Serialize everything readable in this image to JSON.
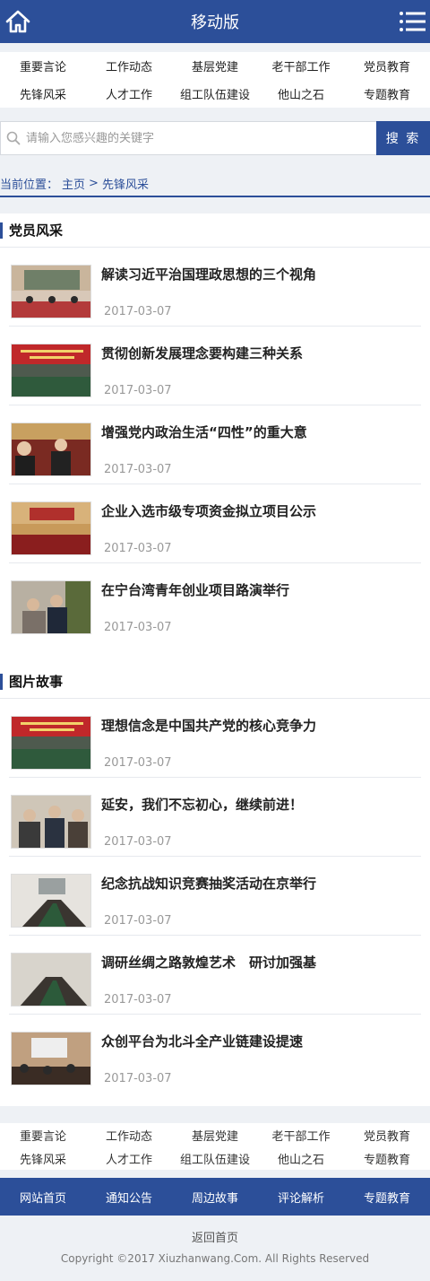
{
  "header": {
    "title": "移动版",
    "home_icon": "home-icon",
    "menu_icon": "menu-icon"
  },
  "topnav": [
    "重要言论",
    "工作动态",
    "基层党建",
    "老干部工作",
    "党员教育",
    "先锋风采",
    "人才工作",
    "组工队伍建设",
    "他山之石",
    "专题教育"
  ],
  "search": {
    "placeholder": "请输入您感兴趣的关键字",
    "button": "搜 索"
  },
  "breadcrumb": {
    "label": "当前位置：",
    "home": "主页",
    "sep": ">",
    "current": "先锋风采"
  },
  "sections": [
    {
      "title": "党员风采",
      "items": [
        {
          "title": "解读习近平治国理政思想的三个视角",
          "date": "2017-03-07"
        },
        {
          "title": "贯彻创新发展理念要构建三种关系",
          "date": "2017-03-07"
        },
        {
          "title": "增强党内政治生活“四性”的重大意",
          "date": "2017-03-07"
        },
        {
          "title": "企业入选市级专项资金拟立项目公示",
          "date": "2017-03-07"
        },
        {
          "title": "在宁台湾青年创业项目路演举行",
          "date": "2017-03-07"
        }
      ]
    },
    {
      "title": "图片故事",
      "items": [
        {
          "title": "理想信念是中国共产党的核心竞争力",
          "date": "2017-03-07"
        },
        {
          "title": "延安，我们不忘初心，继续前进！",
          "date": "2017-03-07"
        },
        {
          "title": "纪念抗战知识竞赛抽奖活动在京举行",
          "date": "2017-03-07"
        },
        {
          "title": "调研丝绸之路敦煌艺术　研讨加强基",
          "date": "2017-03-07"
        },
        {
          "title": "众创平台为北斗全产业链建设提速",
          "date": "2017-03-07"
        }
      ]
    }
  ],
  "bottomnav": [
    "重要言论",
    "工作动态",
    "基层党建",
    "老干部工作",
    "党员教育",
    "先锋风采",
    "人才工作",
    "组工队伍建设",
    "他山之石",
    "专题教育"
  ],
  "footbar": [
    "网站首页",
    "通知公告",
    "周边故事",
    "评论解析",
    "专题教育"
  ],
  "footer": {
    "back_home": "返回首页",
    "copyright": "Copyright ©2017 Xiuzhanwang.Com. All Rights Reserved"
  },
  "colors": {
    "brand": "#2c4f99",
    "background": "#eef1f5"
  }
}
